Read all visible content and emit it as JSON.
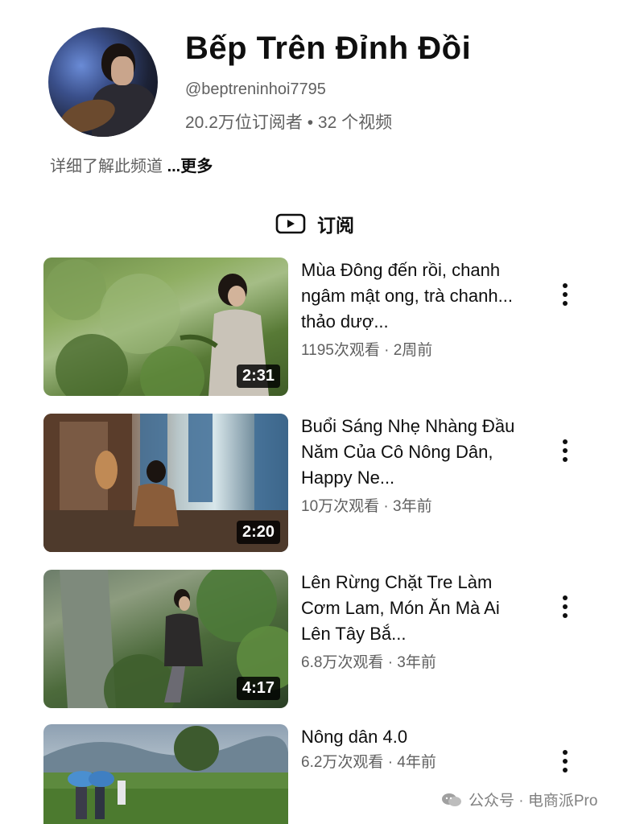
{
  "channel": {
    "name": "Bếp Trên Đỉnh Đồi",
    "handle": "@beptreninhoi7795",
    "stats": "20.2万位订阅者 • 32 个视频",
    "about_text": "详细了解此频道 ",
    "about_more": "...更多"
  },
  "subscribe": {
    "label": "订阅",
    "icon": "play-box-icon"
  },
  "videos": [
    {
      "title": "Mùa Đông đến rồi, chanh ngâm mật ong, trà chanh... thảo dượ...",
      "meta": "1195次观看 · 2周前",
      "duration": "2:31"
    },
    {
      "title": "Buổi Sáng Nhẹ Nhàng Đầu Năm Của Cô Nông Dân, Happy Ne...",
      "meta": "10万次观看 · 3年前",
      "duration": "2:20"
    },
    {
      "title": "Lên Rừng Chặt Tre Làm Cơm Lam, Món Ăn Mà Ai Lên Tây Bắ...",
      "meta": "6.8万次观看 · 3年前",
      "duration": "4:17"
    },
    {
      "title": "Nông dân 4.0",
      "meta": "6.2万次观看 · 4年前",
      "duration": ""
    }
  ],
  "watermark": {
    "text": "公众号 · 电商派Pro",
    "icon": "wechat-icon"
  }
}
